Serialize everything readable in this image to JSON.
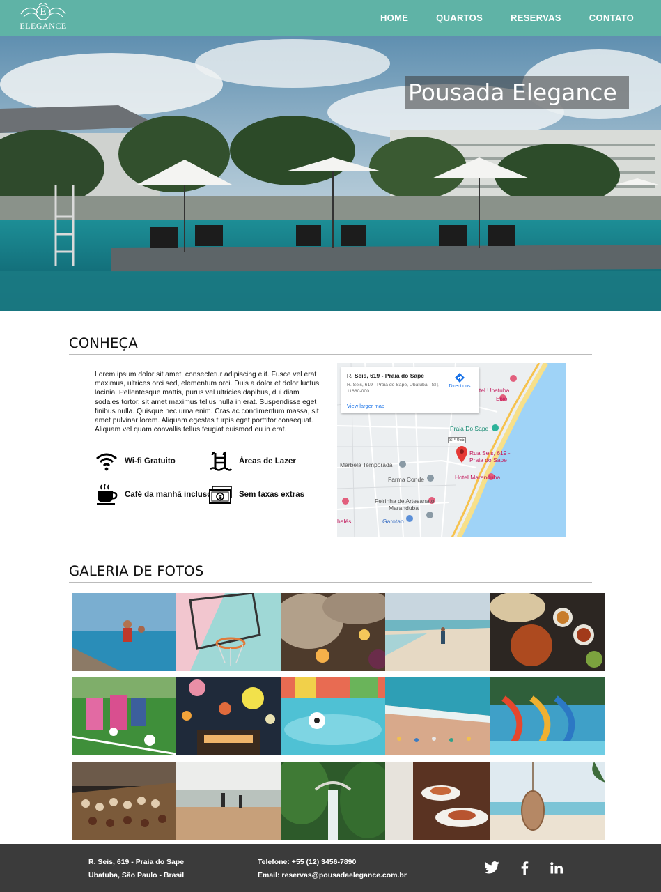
{
  "brand": {
    "logo_text": "ELEGANCE",
    "logo_initial": "E",
    "accent_color": "#5fb3a6"
  },
  "nav": {
    "items": [
      {
        "label": "HOME"
      },
      {
        "label": "QUARTOS"
      },
      {
        "label": "RESERVAS"
      },
      {
        "label": "CONTATO"
      }
    ]
  },
  "hero": {
    "title": "Pousada Elegance"
  },
  "about": {
    "title": "CONHEÇA",
    "text": "Lorem ipsum dolor sit amet, consectetur adipiscing elit. Fusce vel erat maximus, ultrices orci sed, elementum orci. Duis a dolor et dolor luctus lacinia. Pellentesque mattis, purus vel ultricies dapibus, dui diam sodales tortor, sit amet maximus tellus nulla in erat. Suspendisse eget finibus nulla. Quisque nec urna enim. Cras ac condimentum massa, sit amet pulvinar lorem. Aliquam egestas turpis eget porttitor consequat. Aliquam vel quam convallis tellus feugiat euismod eu in erat.",
    "amenities": [
      {
        "label": "Wi-fi Gratuito",
        "icon": "wifi-icon"
      },
      {
        "label": "Áreas de Lazer",
        "icon": "pool-ladder-icon"
      },
      {
        "label": "Café da manhã incluso",
        "icon": "coffee-cup-icon"
      },
      {
        "label": "Sem taxas extras",
        "icon": "money-bill-icon"
      }
    ]
  },
  "map": {
    "card_title": "R. Seis, 619 - Praia do Sape",
    "card_address": "R. Seis, 619 - Praia do Sape, Ubatuba - SP, 11680-000",
    "directions_label": "Directions",
    "larger_map_label": "View larger map",
    "pin_label_line1": "Rua Seis, 619 -",
    "pin_label_line2": "Praia do Sape",
    "places": {
      "hotel_ubatuba": "Hotel Ubatuba",
      "eixo": "Eixo",
      "praia_do_sape": "Praia Do Sape",
      "road_code": "SP-055",
      "marbela": "Marbela Temporada",
      "farma_conde": "Farma Conde",
      "hotel_maranduba": "Hotel Maranduba",
      "feirinha_1": "Feirinha de Artesanato",
      "feirinha_2": "Maranduba",
      "garotao": "Garotao",
      "chales": "halés"
    }
  },
  "gallery": {
    "title": "GALERIA DE FOTOS",
    "photos": [
      "kids-jumping-pool",
      "basketball-hoop",
      "towels-candles",
      "beach-walk",
      "food-plates",
      "kids-soccer",
      "paper-lanterns",
      "ball-in-pool",
      "beach-aerial",
      "water-slides",
      "dessert-buffet",
      "beach-people",
      "waterfall-bridge",
      "waiter-dishes",
      "hanging-chair-beach"
    ]
  },
  "footer": {
    "address_line1": "R. Seis, 619 - Praia do Sape",
    "address_line2": "Ubatuba, São Paulo - Brasil",
    "phone": "Telefone: +55 (12) 3456-7890",
    "email": "Email: reservas@pousadaelegance.com.br",
    "social": [
      "twitter-icon",
      "facebook-icon",
      "linkedin-icon"
    ]
  }
}
